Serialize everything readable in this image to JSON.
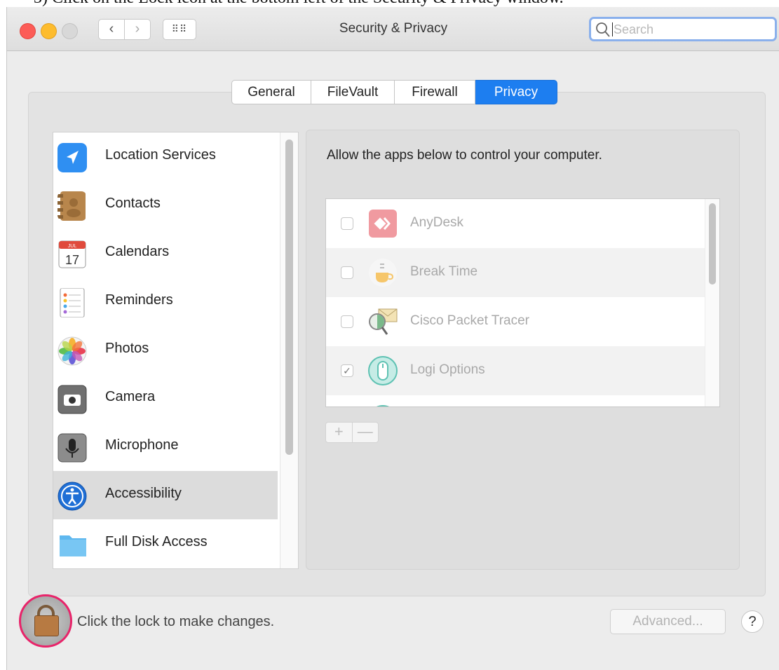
{
  "instruction_text": "3)  Click on the Lock icon at the bottom left of the Security & Privacy window.",
  "window": {
    "title": "Security & Privacy"
  },
  "toolbar": {
    "back_glyph": "‹",
    "forward_glyph": "›",
    "grid_glyph": "⠿⠿",
    "search_placeholder": "Search"
  },
  "tabs": [
    {
      "label": "General",
      "active": false
    },
    {
      "label": "FileVault",
      "active": false
    },
    {
      "label": "Firewall",
      "active": false
    },
    {
      "label": "Privacy",
      "active": true
    }
  ],
  "sidebar": {
    "items": [
      {
        "label": "Location Services",
        "icon": "location-arrow-icon"
      },
      {
        "label": "Contacts",
        "icon": "contacts-book-icon"
      },
      {
        "label": "Calendars",
        "icon": "calendar-icon",
        "icon_month": "JUL",
        "icon_day": "17"
      },
      {
        "label": "Reminders",
        "icon": "reminders-list-icon"
      },
      {
        "label": "Photos",
        "icon": "photos-flower-icon"
      },
      {
        "label": "Camera",
        "icon": "camera-icon"
      },
      {
        "label": "Microphone",
        "icon": "microphone-icon"
      },
      {
        "label": "Accessibility",
        "icon": "accessibility-person-icon",
        "selected": true
      },
      {
        "label": "Full Disk Access",
        "icon": "folder-icon"
      }
    ]
  },
  "main": {
    "description": "Allow the apps below to control your computer.",
    "apps": [
      {
        "label": "AnyDesk",
        "checked": false,
        "icon": "anydesk-icon"
      },
      {
        "label": "Break Time",
        "checked": false,
        "icon": "coffee-cup-icon"
      },
      {
        "label": "Cisco Packet Tracer",
        "checked": false,
        "icon": "packet-tracer-icon"
      },
      {
        "label": "Logi Options",
        "checked": true,
        "icon": "mouse-icon"
      }
    ],
    "add_label": "+",
    "remove_label": "—",
    "check_glyph": "✓"
  },
  "footer": {
    "lock_text": "Click the lock to make changes.",
    "advanced_label": "Advanced...",
    "help_label": "?"
  },
  "colors": {
    "accent": "#1d7ef0",
    "lock_highlight": "#e8246a"
  }
}
